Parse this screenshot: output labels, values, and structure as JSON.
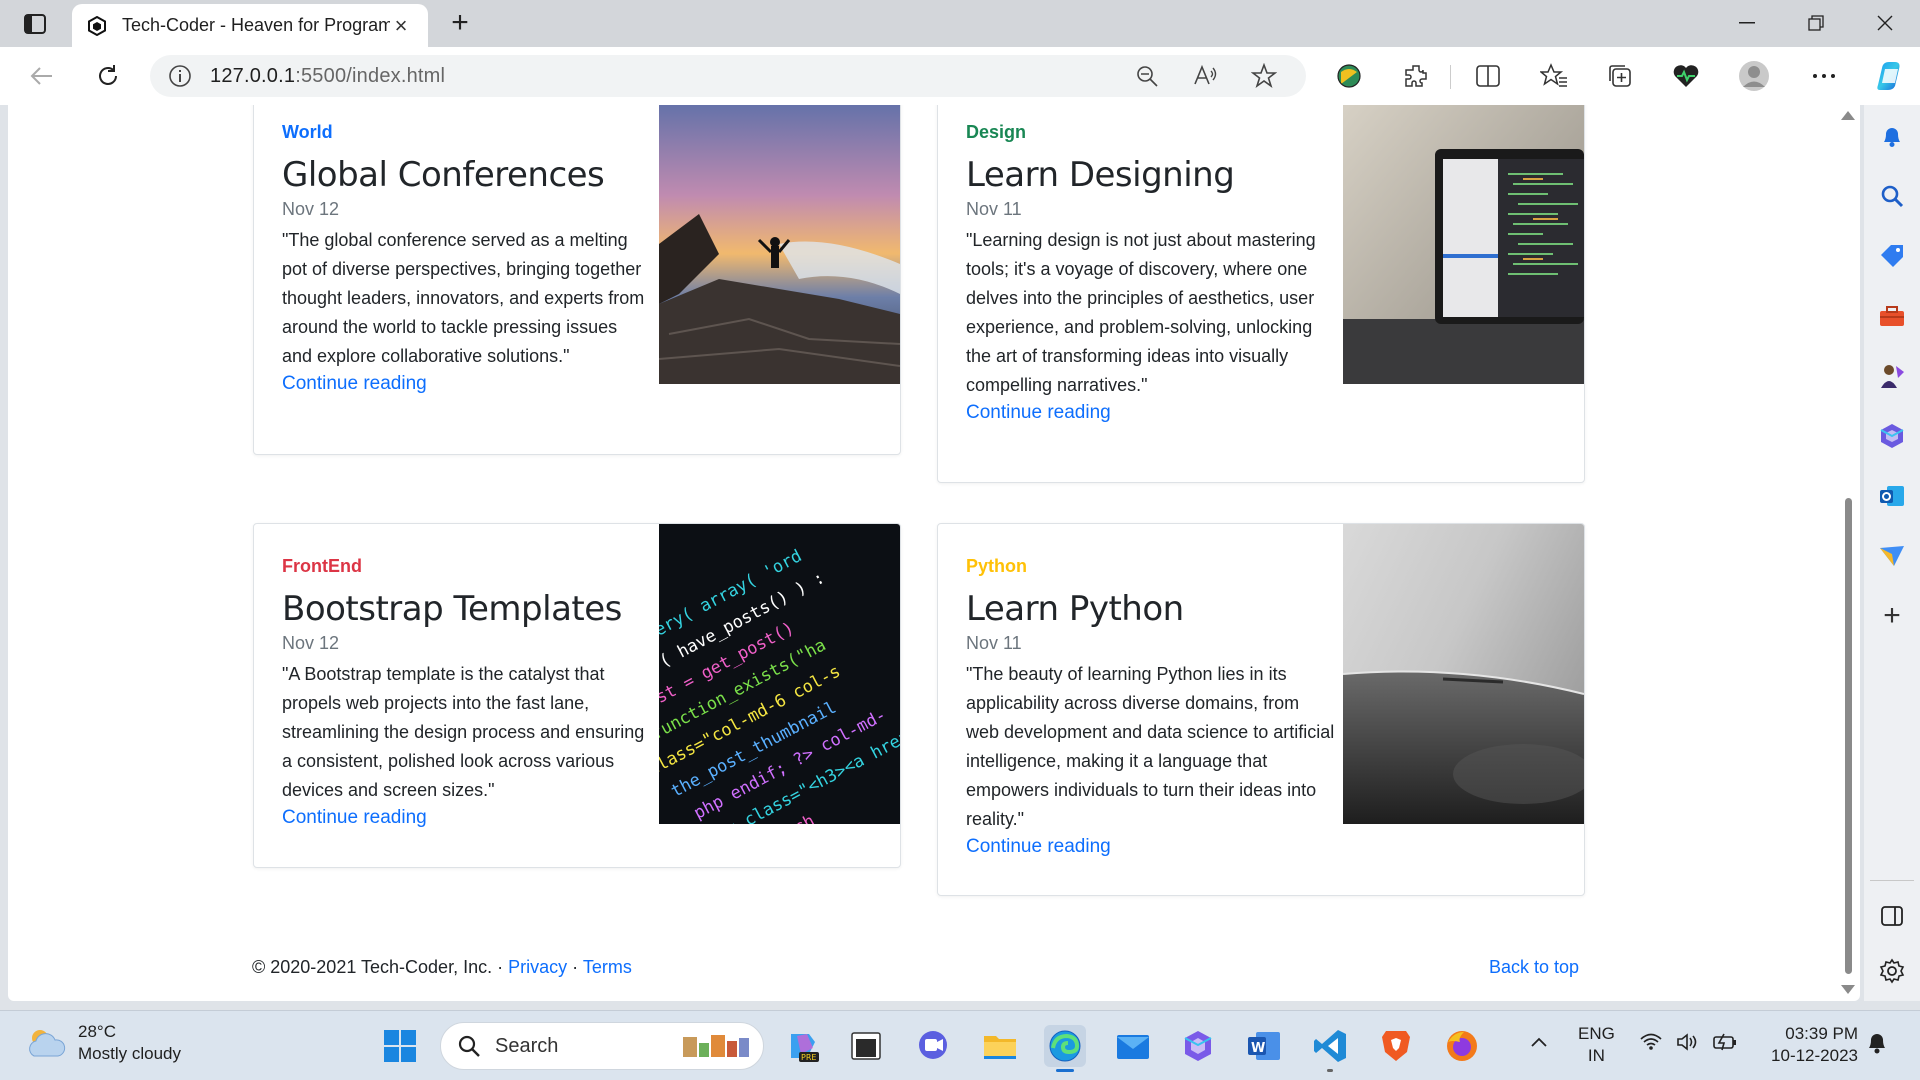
{
  "browser": {
    "tab_title": "Tech-Coder - Heaven for Programmers",
    "url_host": "127.0.0.1",
    "url_rest": ":5500/index.html"
  },
  "posts": [
    {
      "category": "World",
      "category_color": "#0d6efd",
      "title": "Global Conferences",
      "date": "Nov 12",
      "excerpt": "\"The global conference served as a melting pot of diverse perspectives, bringing together thought leaders, innovators, and experts from around the world to tackle pressing issues and explore collaborative solutions.\"",
      "link": "Continue reading",
      "image": "coastal-rocks-photo"
    },
    {
      "category": "Design",
      "category_color": "#198754",
      "title": "Learn Designing",
      "date": "Nov 11",
      "excerpt": "\"Learning design is not just about mastering tools; it's a voyage of discovery, where one delves into the principles of aesthetics, user experience, and problem-solving, unlocking the art of transforming ideas into visually compelling narratives.\"",
      "link": "Continue reading",
      "image": "laptop-photo"
    },
    {
      "category": "FrontEnd",
      "category_color": "#dc3545",
      "title": "Bootstrap Templates",
      "date": "Nov 12",
      "excerpt": "\"A Bootstrap template is the catalyst that propels web projects into the fast lane, streamlining the design process and ensuring a consistent, polished look across various devices and screen sizes.\"",
      "link": "Continue reading",
      "image": "code-screen-photo"
    },
    {
      "category": "Python",
      "category_color": "#ffc107",
      "title": "Learn Python",
      "date": "Nov 11",
      "excerpt": "\"The beauty of learning Python lies in its applicability across diverse domains, from web development and data science to artificial intelligence, making it a language that empowers individuals to turn their ideas into reality.\"",
      "link": "Continue reading",
      "image": "phone-closeup-photo"
    }
  ],
  "footer": {
    "copyright": "© 2020-2021 Tech-Coder, Inc.",
    "separator": "·",
    "privacy": "Privacy",
    "terms": "Terms",
    "back_to_top": "Back to top"
  },
  "taskbar": {
    "temperature": "28°C",
    "weather": "Mostly cloudy",
    "search": "Search",
    "lang_top": "ENG",
    "lang_bottom": "IN",
    "time": "03:39 PM",
    "date": "10-12-2023"
  }
}
